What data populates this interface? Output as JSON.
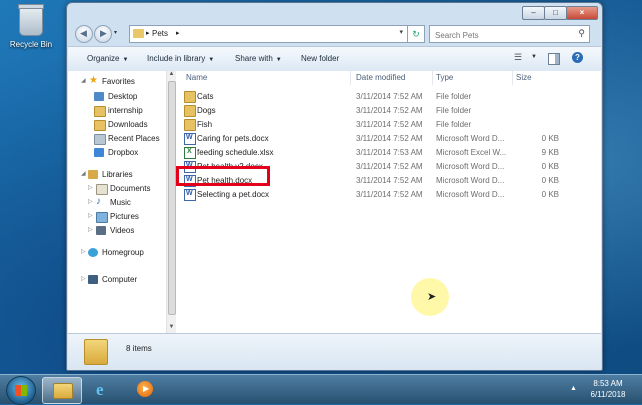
{
  "desktop": {
    "recycle_bin_label": "Recycle Bin"
  },
  "window": {
    "controls": {
      "minimize": "–",
      "maximize": "□",
      "close": "×"
    },
    "address": {
      "path": "Pets",
      "dropdown": "▾"
    },
    "refresh_glyph": "↻",
    "search": {
      "placeholder": "Search Pets",
      "icon": "search-icon"
    }
  },
  "toolbar": {
    "organize": "Organize",
    "include_in_library": "Include in library",
    "share_with": "Share with",
    "new_folder": "New folder"
  },
  "navpane": {
    "favorites": "Favorites",
    "favorites_items": [
      "Desktop",
      "internship",
      "Downloads",
      "Recent Places",
      "Dropbox"
    ],
    "libraries": "Libraries",
    "libraries_items": [
      "Documents",
      "Music",
      "Pictures",
      "Videos"
    ],
    "homegroup": "Homegroup",
    "computer": "Computer"
  },
  "filelist": {
    "columns": {
      "name": "Name",
      "date_modified": "Date modified",
      "type": "Type",
      "size": "Size"
    },
    "rows": [
      {
        "name": "Cats",
        "date": "3/11/2014 7:52 AM",
        "type": "File folder",
        "size": "",
        "icon": "folder-icon"
      },
      {
        "name": "Dogs",
        "date": "3/11/2014 7:52 AM",
        "type": "File folder",
        "size": "",
        "icon": "folder-icon"
      },
      {
        "name": "Fish",
        "date": "3/11/2014 7:52 AM",
        "type": "File folder",
        "size": "",
        "icon": "folder-icon"
      },
      {
        "name": "Caring for pets.docx",
        "date": "3/11/2014 7:52 AM",
        "type": "Microsoft Word D...",
        "size": "0 KB",
        "icon": "word-document-icon"
      },
      {
        "name": "feeding schedule.xlsx",
        "date": "3/11/2014 7:53 AM",
        "type": "Microsoft Excel W...",
        "size": "9 KB",
        "icon": "excel-document-icon"
      },
      {
        "name": "Pet health v2.docx",
        "date": "3/11/2014 7:52 AM",
        "type": "Microsoft Word D...",
        "size": "0 KB",
        "icon": "word-document-icon"
      },
      {
        "name": "Pet health.docx",
        "date": "3/11/2014 7:52 AM",
        "type": "Microsoft Word D...",
        "size": "0 KB",
        "icon": "word-document-icon"
      },
      {
        "name": "Selecting a pet.docx",
        "date": "3/11/2014 7:52 AM",
        "type": "Microsoft Word D...",
        "size": "0 KB",
        "icon": "word-document-icon"
      }
    ],
    "highlighted_item": "Pet health.docx",
    "highlight_color": "#e3001b"
  },
  "details": {
    "item_count": "8 items"
  },
  "taskbar": {
    "time": "8:53 AM",
    "date": "6/11/2018",
    "tray_arrow": "▲"
  }
}
